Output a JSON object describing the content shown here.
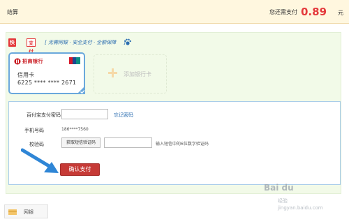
{
  "header": {
    "title": "结算",
    "due_label": "您还需支付",
    "amount": "0.89",
    "unit": "元"
  },
  "quickpay": {
    "badge": "快捷",
    "badge2": "支付",
    "features": "[ 无需网银 · 安全支付 · 全额保障",
    "end_bracket": "]"
  },
  "card": {
    "bank_name": "招商银行",
    "type": "信用卡",
    "number": "6225 **** **** 2671"
  },
  "add_card": {
    "label": "添加银行卡"
  },
  "form": {
    "password_label": "百付宝支付密码",
    "forgot_link": "忘记密码",
    "phone_label": "手机号码",
    "phone_value": "186****7560",
    "code_label": "校验码",
    "get_code_button": "获取短信验证码",
    "code_hint": "输入短信中的6位数字验证码",
    "confirm_button": "确认支付"
  },
  "bottom": {
    "label": "网银"
  },
  "watermark": {
    "logo": "Bai du",
    "text": "经验",
    "url": "jingyan.baidu.com"
  },
  "colors": {
    "accent_red": "#e4393c",
    "link_blue": "#2b6db0",
    "panel_green": "#f2fae8",
    "card_border_blue": "#6aa8dc",
    "arrow_blue": "#2f86d6"
  },
  "icons": [
    "paw-icon",
    "bank-logo-icon",
    "unionpay-icon",
    "check-icon",
    "plus-icon",
    "arrow-icon",
    "bank-icon"
  ]
}
